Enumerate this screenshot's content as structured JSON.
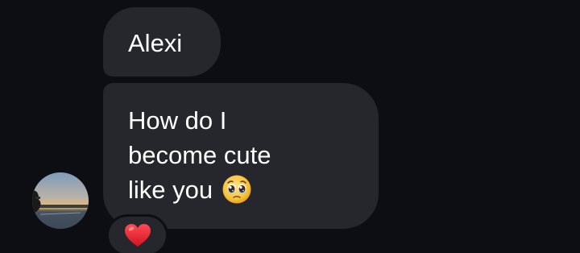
{
  "conversation": {
    "messages": [
      {
        "text": "Alexi"
      },
      {
        "lines": [
          "How do I",
          "become cute",
          "like you"
        ],
        "emoji": "pleading-face-icon"
      }
    ],
    "reaction": {
      "emoji": "red-heart-icon"
    },
    "sender_avatar": {
      "icon": "avatar-sunset-photo"
    }
  },
  "colors": {
    "background": "#0c0e13",
    "bubble": "#25272d",
    "text": "#ffffff",
    "heart": "#e8232f"
  }
}
